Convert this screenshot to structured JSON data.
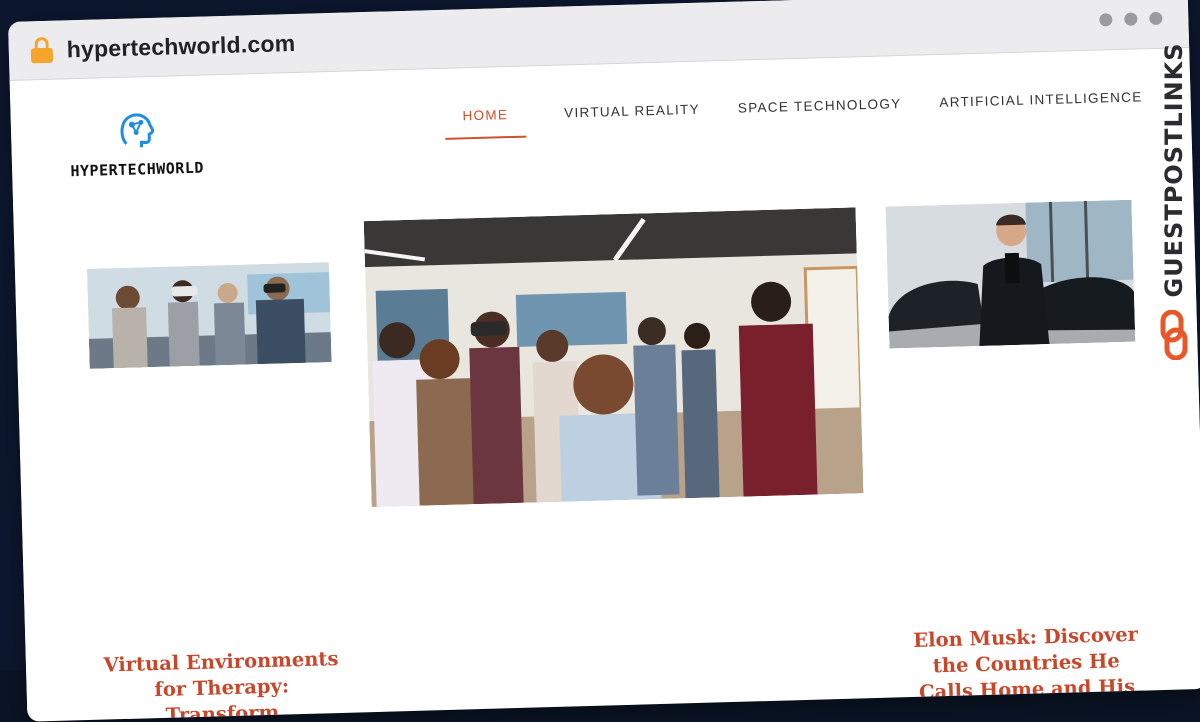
{
  "browser": {
    "url": "hypertechworld.com"
  },
  "site": {
    "logo_text": "HYPERTECHWORLD"
  },
  "nav": {
    "items": [
      {
        "label": "HOME",
        "active": true
      },
      {
        "label": "VIRTUAL REALITY",
        "active": false
      },
      {
        "label": "SPACE TECHNOLOGY",
        "active": false
      },
      {
        "label": "ARTIFICIAL INTELLIGENCE",
        "active": false
      }
    ]
  },
  "posts": {
    "left_title": "Virtual Environments for Therapy: Transform",
    "right_title": "Elon Musk: Discover the Countries He Calls Home and His Global"
  },
  "watermark": {
    "text": "GUESTPOSTLINKS"
  },
  "colors": {
    "accent": "#d0512e",
    "watermark": "#2b2b30",
    "watermark_icon": "#e8572a"
  },
  "icons": {
    "lock": "lock-icon",
    "logo": "brain-circuit-icon",
    "watermark_icon": "link-icon"
  }
}
